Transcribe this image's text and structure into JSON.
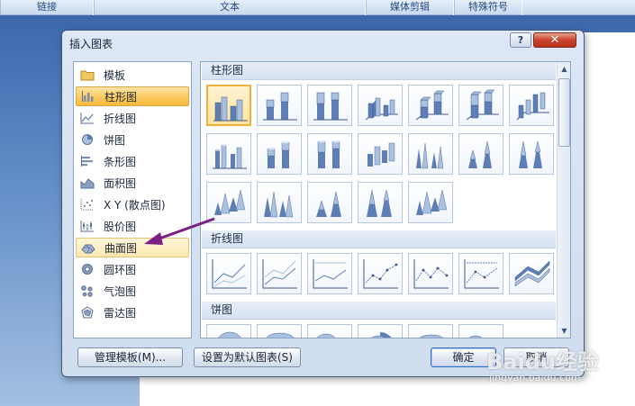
{
  "ribbon": {
    "groups": [
      {
        "label": "链接"
      },
      {
        "label": "文本"
      },
      {
        "label": "媒体剪辑"
      },
      {
        "label": "特殊符号"
      }
    ]
  },
  "dialog": {
    "title": "插入图表",
    "help_label": "?",
    "close_label": "✕"
  },
  "categories": [
    {
      "label": "模板",
      "icon": "folder-icon"
    },
    {
      "label": "柱形图",
      "icon": "column-chart-icon"
    },
    {
      "label": "折线图",
      "icon": "line-chart-icon"
    },
    {
      "label": "饼图",
      "icon": "pie-chart-icon"
    },
    {
      "label": "条形图",
      "icon": "bar-chart-icon"
    },
    {
      "label": "面积图",
      "icon": "area-chart-icon"
    },
    {
      "label": "X Y (散点图)",
      "icon": "scatter-chart-icon"
    },
    {
      "label": "股价图",
      "icon": "stock-chart-icon"
    },
    {
      "label": "曲面图",
      "icon": "surface-chart-icon"
    },
    {
      "label": "圆环图",
      "icon": "doughnut-chart-icon"
    },
    {
      "label": "气泡图",
      "icon": "bubble-chart-icon"
    },
    {
      "label": "雷达图",
      "icon": "radar-chart-icon"
    }
  ],
  "selected_category": "柱形图",
  "hovered_category": "曲面图",
  "gallery": {
    "sections": [
      {
        "label": "柱形图"
      },
      {
        "label": "折线图"
      },
      {
        "label": "饼图"
      }
    ]
  },
  "buttons": {
    "manage_templates": "管理模板(M)...",
    "set_default": "设置为默认图表(S)",
    "ok": "确定",
    "cancel": "取消"
  },
  "watermark": {
    "brand": "Baidu经验",
    "url": "jingyan.baidu.com"
  },
  "colors": {
    "selection": "#fbca5e",
    "annotation_arrow": "#7a1f86",
    "close_button": "#c9452a"
  }
}
